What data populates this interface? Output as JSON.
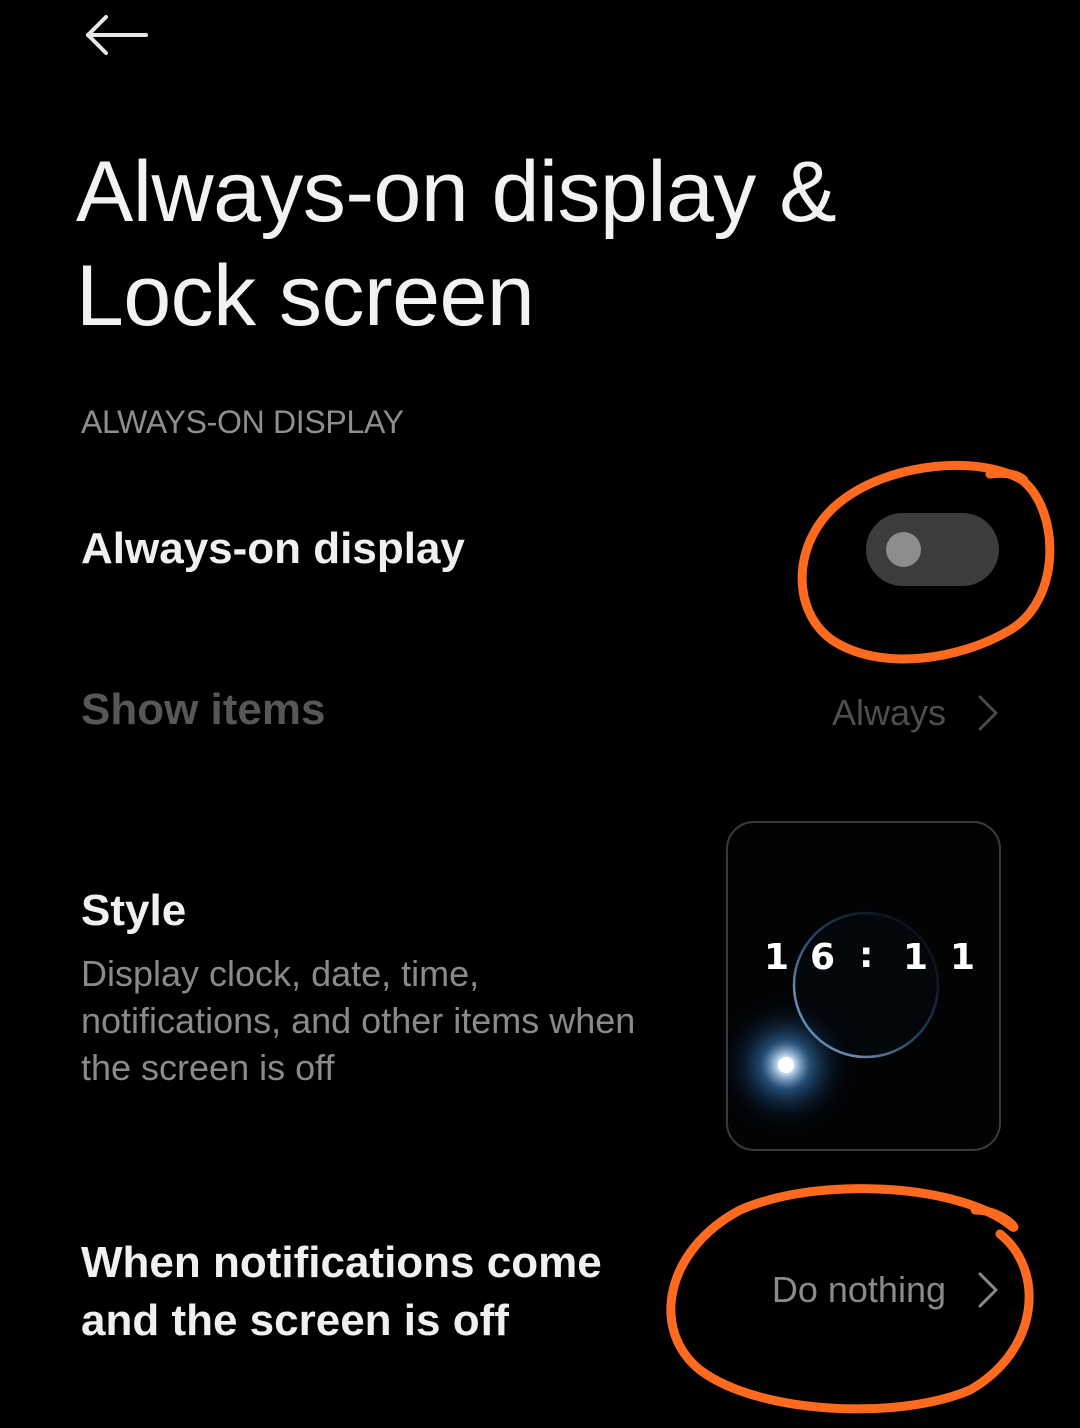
{
  "header": {
    "back_icon": "arrow-left-icon",
    "title": "Always-on display & Lock screen"
  },
  "section": {
    "label": "ALWAYS-ON DISPLAY"
  },
  "always_on": {
    "label": "Always-on display",
    "toggle_state": "off"
  },
  "show_items": {
    "label": "Show items",
    "value": "Always",
    "chevron_icon": "chevron-right-icon"
  },
  "style": {
    "label": "Style",
    "description": "Display clock, date, time, notifications, and other items when the screen is off",
    "preview": {
      "digits": [
        "1",
        "6",
        ":",
        "1",
        "1"
      ]
    }
  },
  "notifications": {
    "label": "When notifications come and the screen is off",
    "value": "Do nothing",
    "chevron_icon": "chevron-right-icon"
  },
  "colors": {
    "background": "#000000",
    "annotation": "#ff6a1f"
  }
}
